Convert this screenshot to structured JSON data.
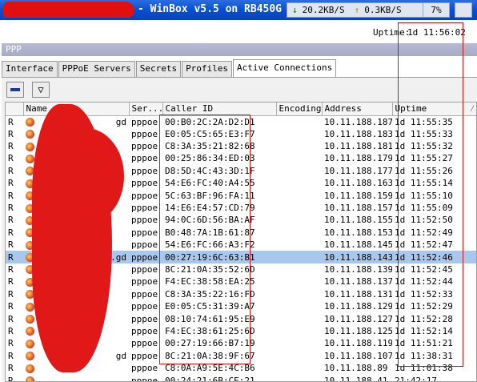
{
  "window": {
    "title": "- WinBox v5.5 on RB450G",
    "traffic_down": "20.2KB/S",
    "traffic_up": "0.3KB/S",
    "cpu": "7%"
  },
  "system": {
    "uptime_label": "Uptime:",
    "uptime_value": "1d 11:56:02"
  },
  "ppp": {
    "title": "PPP",
    "tabs": [
      "Interface",
      "PPPoE Servers",
      "Secrets",
      "Profiles",
      "Active Connections"
    ],
    "active_tab": "Active Connections",
    "columns": [
      "Name",
      "Ser...",
      "Caller ID",
      "Encoding",
      "Address",
      "Uptime"
    ],
    "rows": [
      {
        "flag": "R",
        "name": "gd",
        "service": "pppoe",
        "caller_id": "00:B0:2C:2A:D2:D1",
        "encoding": "",
        "address": "10.11.188.187",
        "uptime": "1d 11:55:35"
      },
      {
        "flag": "R",
        "name": "",
        "service": "pppoe",
        "caller_id": "E0:05:C5:65:E3:F7",
        "encoding": "",
        "address": "10.11.188.183",
        "uptime": "1d 11:55:33"
      },
      {
        "flag": "R",
        "name": "",
        "service": "pppoe",
        "caller_id": "C8:3A:35:21:82:68",
        "encoding": "",
        "address": "10.11.188.181",
        "uptime": "1d 11:55:32"
      },
      {
        "flag": "R",
        "name": "",
        "service": "pppoe",
        "caller_id": "00:25:86:34:ED:03",
        "encoding": "",
        "address": "10.11.188.179",
        "uptime": "1d 11:55:27"
      },
      {
        "flag": "R",
        "name": "",
        "service": "pppoe",
        "caller_id": "D8:5D:4C:43:3D:1F",
        "encoding": "",
        "address": "10.11.188.177",
        "uptime": "1d 11:55:26"
      },
      {
        "flag": "R",
        "name": "",
        "service": "pppoe",
        "caller_id": "54:E6:FC:40:A4:55",
        "encoding": "",
        "address": "10.11.188.163",
        "uptime": "1d 11:55:14"
      },
      {
        "flag": "R",
        "name": "",
        "service": "pppoe",
        "caller_id": "5C:63:BF:96:FA:11",
        "encoding": "",
        "address": "10.11.188.159",
        "uptime": "1d 11:55:10"
      },
      {
        "flag": "R",
        "name": "",
        "service": "pppoe",
        "caller_id": "14:E6:E4:57:CD:79",
        "encoding": "",
        "address": "10.11.188.157",
        "uptime": "1d 11:55:09"
      },
      {
        "flag": "R",
        "name": "",
        "service": "pppoe",
        "caller_id": "94:0C:6D:56:BA:AF",
        "encoding": "",
        "address": "10.11.188.155",
        "uptime": "1d 11:52:50"
      },
      {
        "flag": "R",
        "name": "",
        "service": "pppoe",
        "caller_id": "B0:48:7A:1B:61:87",
        "encoding": "",
        "address": "10.11.188.153",
        "uptime": "1d 11:52:49"
      },
      {
        "flag": "R",
        "name": "",
        "service": "pppoe",
        "caller_id": "54:E6:FC:66:A3:F2",
        "encoding": "",
        "address": "10.11.188.145",
        "uptime": "1d 11:52:47"
      },
      {
        "flag": "R",
        "name": "w.gd",
        "service": "pppoe",
        "caller_id": "00:27:19:6C:63:B1",
        "encoding": "",
        "address": "10.11.188.143",
        "uptime": "1d 11:52:46",
        "selected": true
      },
      {
        "flag": "R",
        "name": "",
        "service": "pppoe",
        "caller_id": "8C:21:0A:35:52:6D",
        "encoding": "",
        "address": "10.11.188.139",
        "uptime": "1d 11:52:45"
      },
      {
        "flag": "R",
        "name": "",
        "service": "pppoe",
        "caller_id": "F4:EC:38:58:EA:25",
        "encoding": "",
        "address": "10.11.188.137",
        "uptime": "1d 11:52:44"
      },
      {
        "flag": "R",
        "name": "",
        "service": "pppoe",
        "caller_id": "C8:3A:35:22:16:FD",
        "encoding": "",
        "address": "10.11.188.131",
        "uptime": "1d 11:52:33"
      },
      {
        "flag": "R",
        "name": "",
        "service": "pppoe",
        "caller_id": "E0:05:C5:31:39:A7",
        "encoding": "",
        "address": "10.11.188.129",
        "uptime": "1d 11:52:29"
      },
      {
        "flag": "R",
        "name": "",
        "service": "pppoe",
        "caller_id": "08:10:74:61:95:E9",
        "encoding": "",
        "address": "10.11.188.127",
        "uptime": "1d 11:52:28"
      },
      {
        "flag": "R",
        "name": "",
        "service": "pppoe",
        "caller_id": "F4:EC:38:61:25:6D",
        "encoding": "",
        "address": "10.11.188.125",
        "uptime": "1d 11:52:14"
      },
      {
        "flag": "R",
        "name": "",
        "service": "pppoe",
        "caller_id": "00:27:19:66:B7:19",
        "encoding": "",
        "address": "10.11.188.119",
        "uptime": "1d 11:51:21"
      },
      {
        "flag": "R",
        "name": "gd",
        "service": "pppoe",
        "caller_id": "8C:21:0A:38:9F:67",
        "encoding": "",
        "address": "10.11.188.107",
        "uptime": "1d 11:38:31"
      },
      {
        "flag": "R",
        "name": "",
        "service": "pppoe",
        "caller_id": "C8:0A:A9:5E:4C:B6",
        "encoding": "",
        "address": "10.11.188.89",
        "uptime": "1d 11:01:38"
      },
      {
        "flag": "R",
        "name": "",
        "service": "pppoe",
        "caller_id": "00:24:21:6B:CE:21",
        "encoding": "",
        "address": "10.11.188.41",
        "uptime": "21:42:17"
      }
    ]
  },
  "colors": {
    "selected_row": "#a9c7ec",
    "titlebar": "#0a4fd0",
    "annotation": "#e01010"
  }
}
